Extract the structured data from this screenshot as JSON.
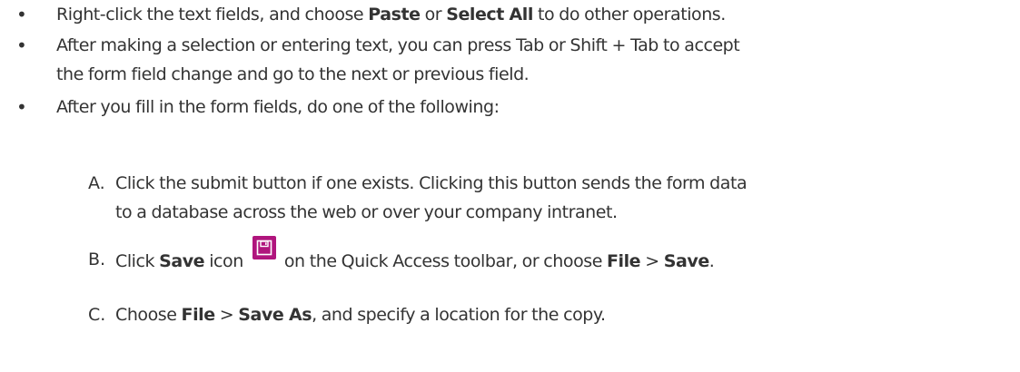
{
  "bullets": [
    {
      "mark": "•",
      "t1": "Right-click the text fields, and choose ",
      "b1": "Paste",
      "t2": " or ",
      "b2": "Select All",
      "t3": " to do other operations."
    },
    {
      "mark": "•",
      "line1": "After making a selection or entering text, you can press Tab or Shift + Tab to accept",
      "line2": "the form field change and go to the next or previous field."
    },
    {
      "mark": "•",
      "text": "After you fill in the form fields, do one of the following:"
    }
  ],
  "steps": [
    {
      "letter": "A.",
      "line1": "Click the submit button if one exists. Clicking this button sends the form data",
      "line2": "to a database across the web or over your company intranet."
    },
    {
      "letter": "B.",
      "t1": "Click ",
      "b1": "Save",
      "t2": " icon",
      "t3": " on the Quick Access toolbar, or choose ",
      "b2": "File",
      "t4": " > ",
      "b3": "Save",
      "t5": ".",
      "icon": "save-icon",
      "icon_color": "#b0157d"
    },
    {
      "letter": "C.",
      "t1": "Choose ",
      "b1": "File",
      "t2": " > ",
      "b2": "Save As",
      "t3": ", and specify a location for the copy."
    }
  ]
}
